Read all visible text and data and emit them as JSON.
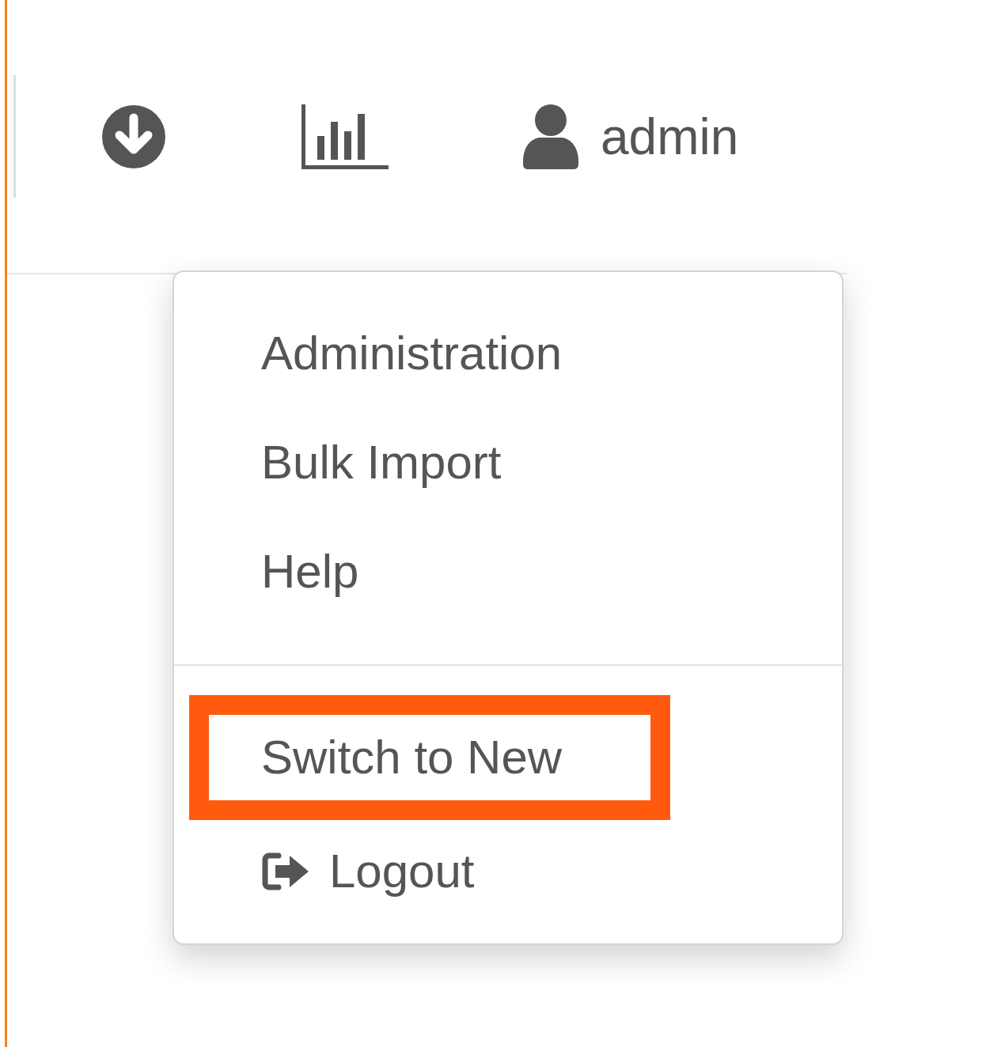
{
  "top_bar": {
    "username": "admin"
  },
  "dropdown": {
    "items": [
      {
        "kind": "link",
        "label": "Administration",
        "highlighted": false
      },
      {
        "kind": "link",
        "label": "Bulk Import",
        "highlighted": false
      },
      {
        "kind": "link",
        "label": "Help",
        "highlighted": false
      },
      {
        "kind": "divider"
      },
      {
        "kind": "link",
        "label": "Switch to New",
        "highlighted": true
      },
      {
        "kind": "logout",
        "label": "Logout",
        "highlighted": false
      }
    ]
  }
}
